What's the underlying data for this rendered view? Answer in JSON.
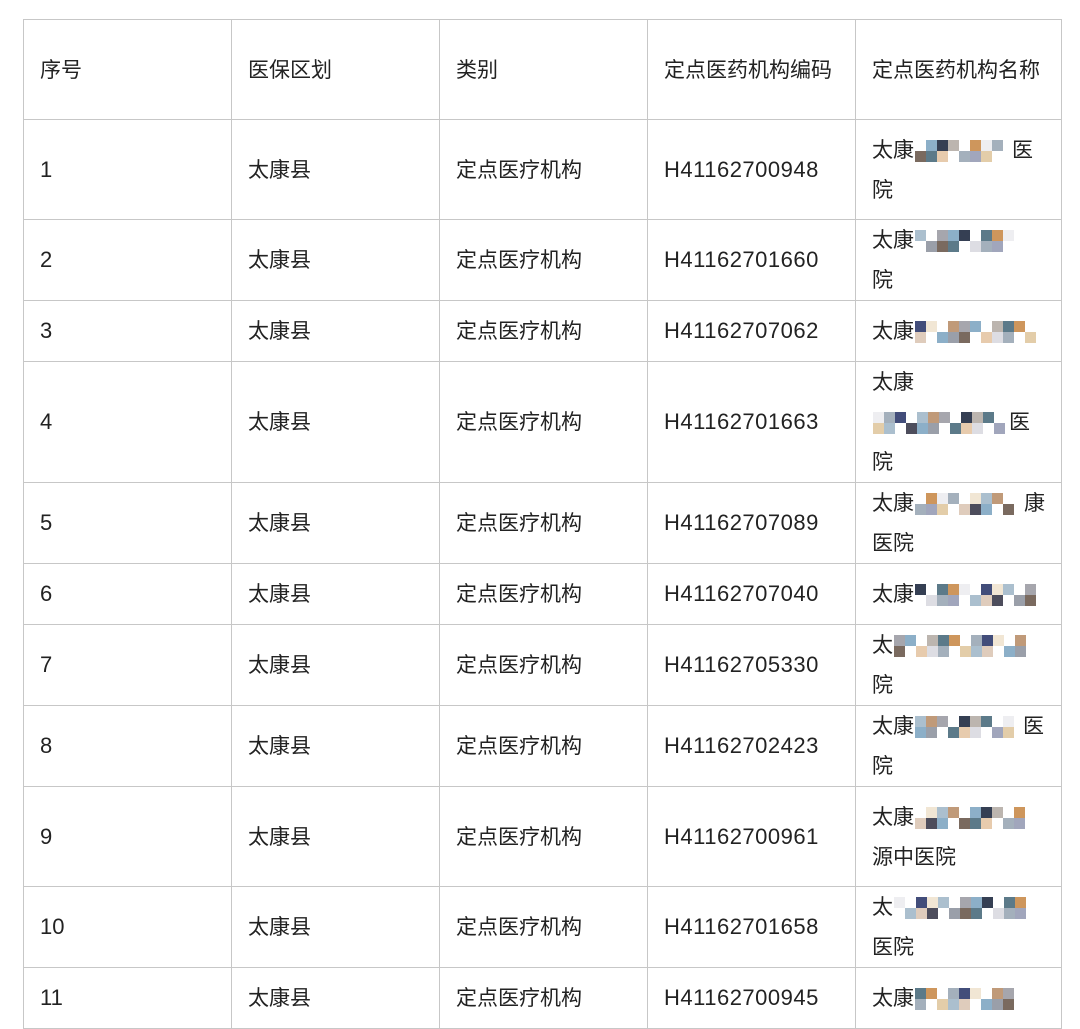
{
  "table": {
    "headers": [
      "序号",
      "医保区划",
      "类别",
      "定点医药机构编码",
      "定点医药机构名称"
    ],
    "rows": [
      {
        "no": "1",
        "region": "太康县",
        "category": "定点医疗机构",
        "code": "H41162700948",
        "name_prefix": "太康",
        "name_suffix": "医院",
        "tall": true
      },
      {
        "no": "2",
        "region": "太康县",
        "category": "定点医疗机构",
        "code": "H41162701660",
        "name_prefix": "太康",
        "name_suffix": "院",
        "tall": false
      },
      {
        "no": "3",
        "region": "太康县",
        "category": "定点医疗机构",
        "code": "H41162707062",
        "name_prefix": "太康",
        "name_suffix": "",
        "tall": false
      },
      {
        "no": "4",
        "region": "太康县",
        "category": "定点医疗机构",
        "code": "H41162701663",
        "name_prefix": "太康",
        "name_suffix": "医院",
        "tall": false
      },
      {
        "no": "5",
        "region": "太康县",
        "category": "定点医疗机构",
        "code": "H41162707089",
        "name_prefix": "太康",
        "name_suffix": "康医院",
        "tall": false
      },
      {
        "no": "6",
        "region": "太康县",
        "category": "定点医疗机构",
        "code": "H41162707040",
        "name_prefix": "太康",
        "name_suffix": "",
        "tall": false
      },
      {
        "no": "7",
        "region": "太康县",
        "category": "定点医疗机构",
        "code": "H41162705330",
        "name_prefix": "太",
        "name_suffix": "院",
        "tall": false
      },
      {
        "no": "8",
        "region": "太康县",
        "category": "定点医疗机构",
        "code": "H41162702423",
        "name_prefix": "太康",
        "name_suffix": "医院",
        "tall": false
      },
      {
        "no": "9",
        "region": "太康县",
        "category": "定点医疗机构",
        "code": "H41162700961",
        "name_prefix": "太康",
        "name_suffix": "源中医院",
        "tall": true
      },
      {
        "no": "10",
        "region": "太康县",
        "category": "定点医疗机构",
        "code": "H41162701658",
        "name_prefix": "太",
        "name_suffix": "医院",
        "tall": false
      },
      {
        "no": "11",
        "region": "太康县",
        "category": "定点医疗机构",
        "code": "H41162700945",
        "name_prefix": "太康",
        "name_suffix": "",
        "tall": false
      }
    ]
  },
  "redaction": {
    "palette": [
      "#3a3a4a",
      "#c98b4a",
      "#a2b8c9",
      "#6b5a4e",
      "#2e3a6b",
      "#7fa6c2",
      "#d9d9e0",
      "#b98f6a",
      "#4a6b7c",
      "#e0c8a0",
      "#1f2a40",
      "#9aa7b5"
    ]
  }
}
